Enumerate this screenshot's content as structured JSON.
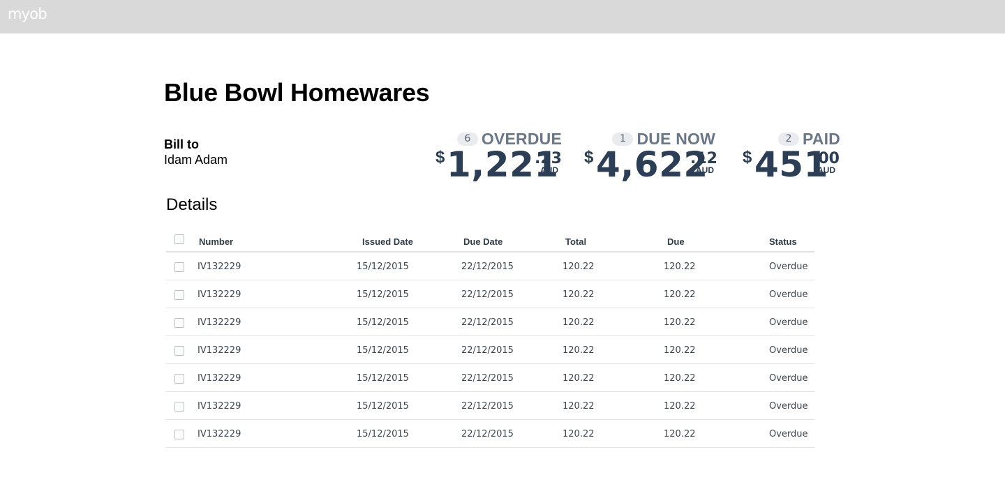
{
  "header": {
    "logo": "myob"
  },
  "page": {
    "title": "Blue Bowl Homewares"
  },
  "bill_to": {
    "label": "Bill to",
    "name": "Idam Adam"
  },
  "stats": [
    {
      "count": "6",
      "label": "OVERDUE",
      "currency_symbol": "$",
      "integer": "1,221",
      "decimal": ".23",
      "currency": "AUD"
    },
    {
      "count": "1",
      "label": "DUE NOW",
      "currency_symbol": "$",
      "integer": "4,622",
      "decimal": ".12",
      "currency": "AUD"
    },
    {
      "count": "2",
      "label": "PAID",
      "currency_symbol": "$",
      "integer": "451",
      "decimal": ".00",
      "currency": "AUD"
    }
  ],
  "details": {
    "heading": "Details",
    "columns": {
      "number": "Number",
      "issued_date": "Issued Date",
      "due_date": "Due Date",
      "total": "Total",
      "due": "Due",
      "status": "Status"
    },
    "rows": [
      {
        "number": "IV132229",
        "issued_date": "15/12/2015",
        "due_date": "22/12/2015",
        "total": "120.22",
        "due": "120.22",
        "status": "Overdue"
      },
      {
        "number": "IV132229",
        "issued_date": "15/12/2015",
        "due_date": "22/12/2015",
        "total": "120.22",
        "due": "120.22",
        "status": "Overdue"
      },
      {
        "number": "IV132229",
        "issued_date": "15/12/2015",
        "due_date": "22/12/2015",
        "total": "120.22",
        "due": "120.22",
        "status": "Overdue"
      },
      {
        "number": "IV132229",
        "issued_date": "15/12/2015",
        "due_date": "22/12/2015",
        "total": "120.22",
        "due": "120.22",
        "status": "Overdue"
      },
      {
        "number": "IV132229",
        "issued_date": "15/12/2015",
        "due_date": "22/12/2015",
        "total": "120.22",
        "due": "120.22",
        "status": "Overdue"
      },
      {
        "number": "IV132229",
        "issued_date": "15/12/2015",
        "due_date": "22/12/2015",
        "total": "120.22",
        "due": "120.22",
        "status": "Overdue"
      },
      {
        "number": "IV132229",
        "issued_date": "15/12/2015",
        "due_date": "22/12/2015",
        "total": "120.22",
        "due": "120.22",
        "status": "Overdue"
      }
    ]
  }
}
